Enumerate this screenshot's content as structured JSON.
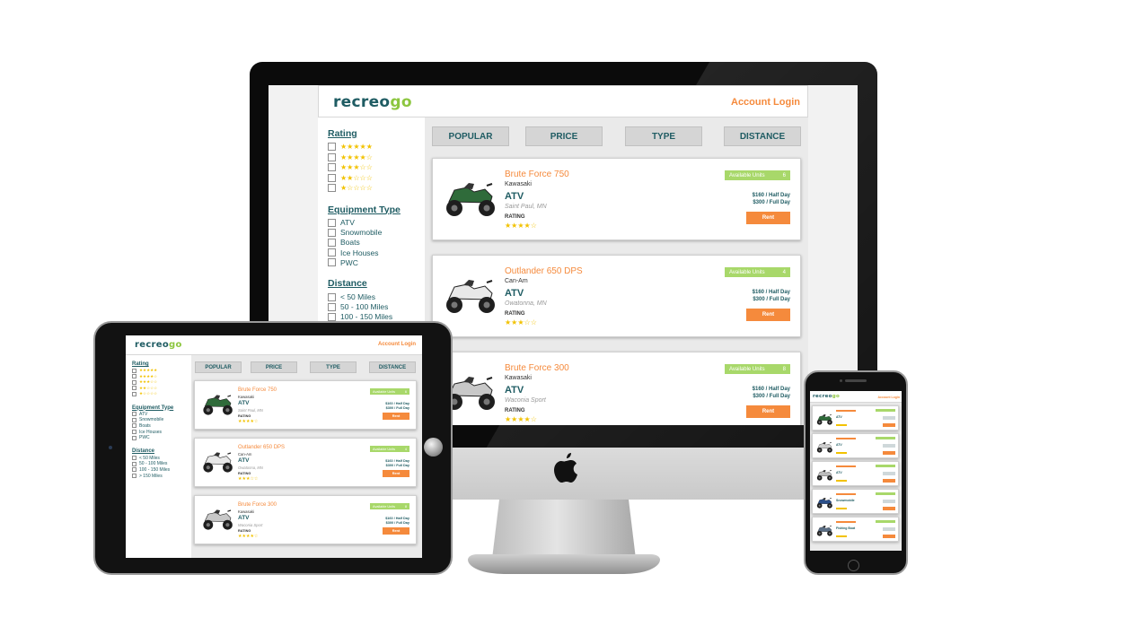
{
  "brand": {
    "logo_part1": "recreo",
    "logo_part2": "go",
    "login": "Account Login"
  },
  "filters": {
    "rating_title": "Rating",
    "rating_options": [
      "★★★★★",
      "★★★★☆",
      "★★★☆☆",
      "★★☆☆☆",
      "★☆☆☆☆"
    ],
    "type_title": "Equipment Type",
    "type_options": [
      "ATV",
      "Snowmobile",
      "Boats",
      "Ice Houses",
      "PWC"
    ],
    "distance_title": "Distance",
    "distance_options": [
      "< 50 Miles",
      "50 - 100 Miles",
      "100 - 150 Miles",
      "> 150 Miles"
    ]
  },
  "sort_tabs": [
    "POPULAR",
    "PRICE",
    "TYPE",
    "DISTANCE"
  ],
  "listings": [
    {
      "title": "Brute Force 750",
      "brand": "Kawasaki",
      "type": "ATV",
      "location": "Saint Paul, MN",
      "rating_label": "RATING",
      "stars": "★★★★☆",
      "avail_label": "Available Units",
      "avail_count": "6",
      "half_day": "$160 / Half Day",
      "full_day": "$300 / Full Day",
      "rent": "Rent"
    },
    {
      "title": "Outlander 650 DPS",
      "brand": "Can-Am",
      "type": "ATV",
      "location": "Owatonna, MN",
      "rating_label": "RATING",
      "stars": "★★★☆☆",
      "avail_label": "Available Units",
      "avail_count": "4",
      "half_day": "$160 / Half Day",
      "full_day": "$300 / Full Day",
      "rent": "Rent"
    },
    {
      "title": "Brute Force 300",
      "brand": "Kawasaki",
      "type": "ATV",
      "location": "Waconia Sport",
      "rating_label": "RATING",
      "stars": "★★★★☆",
      "avail_label": "Available Units",
      "avail_count": "8",
      "half_day": "$160 / Half Day",
      "full_day": "$300 / Full Day",
      "rent": "Rent"
    }
  ],
  "phone_listings": [
    {
      "type": "ATV"
    },
    {
      "type": "ATV"
    },
    {
      "type": "ATV"
    },
    {
      "type": "Snowmobile"
    },
    {
      "type": "Fishing Boat"
    }
  ],
  "colors": {
    "teal": "#1f5c63",
    "green": "#8cc63f",
    "orange": "#f58a3c",
    "avail_green": "#a8d86a",
    "star": "#f2c200"
  },
  "icons": {
    "computer_logo": "apple-logo-icon",
    "vehicle": "atv-icon",
    "snowmobile": "snowmobile-icon",
    "boat": "boat-icon"
  }
}
